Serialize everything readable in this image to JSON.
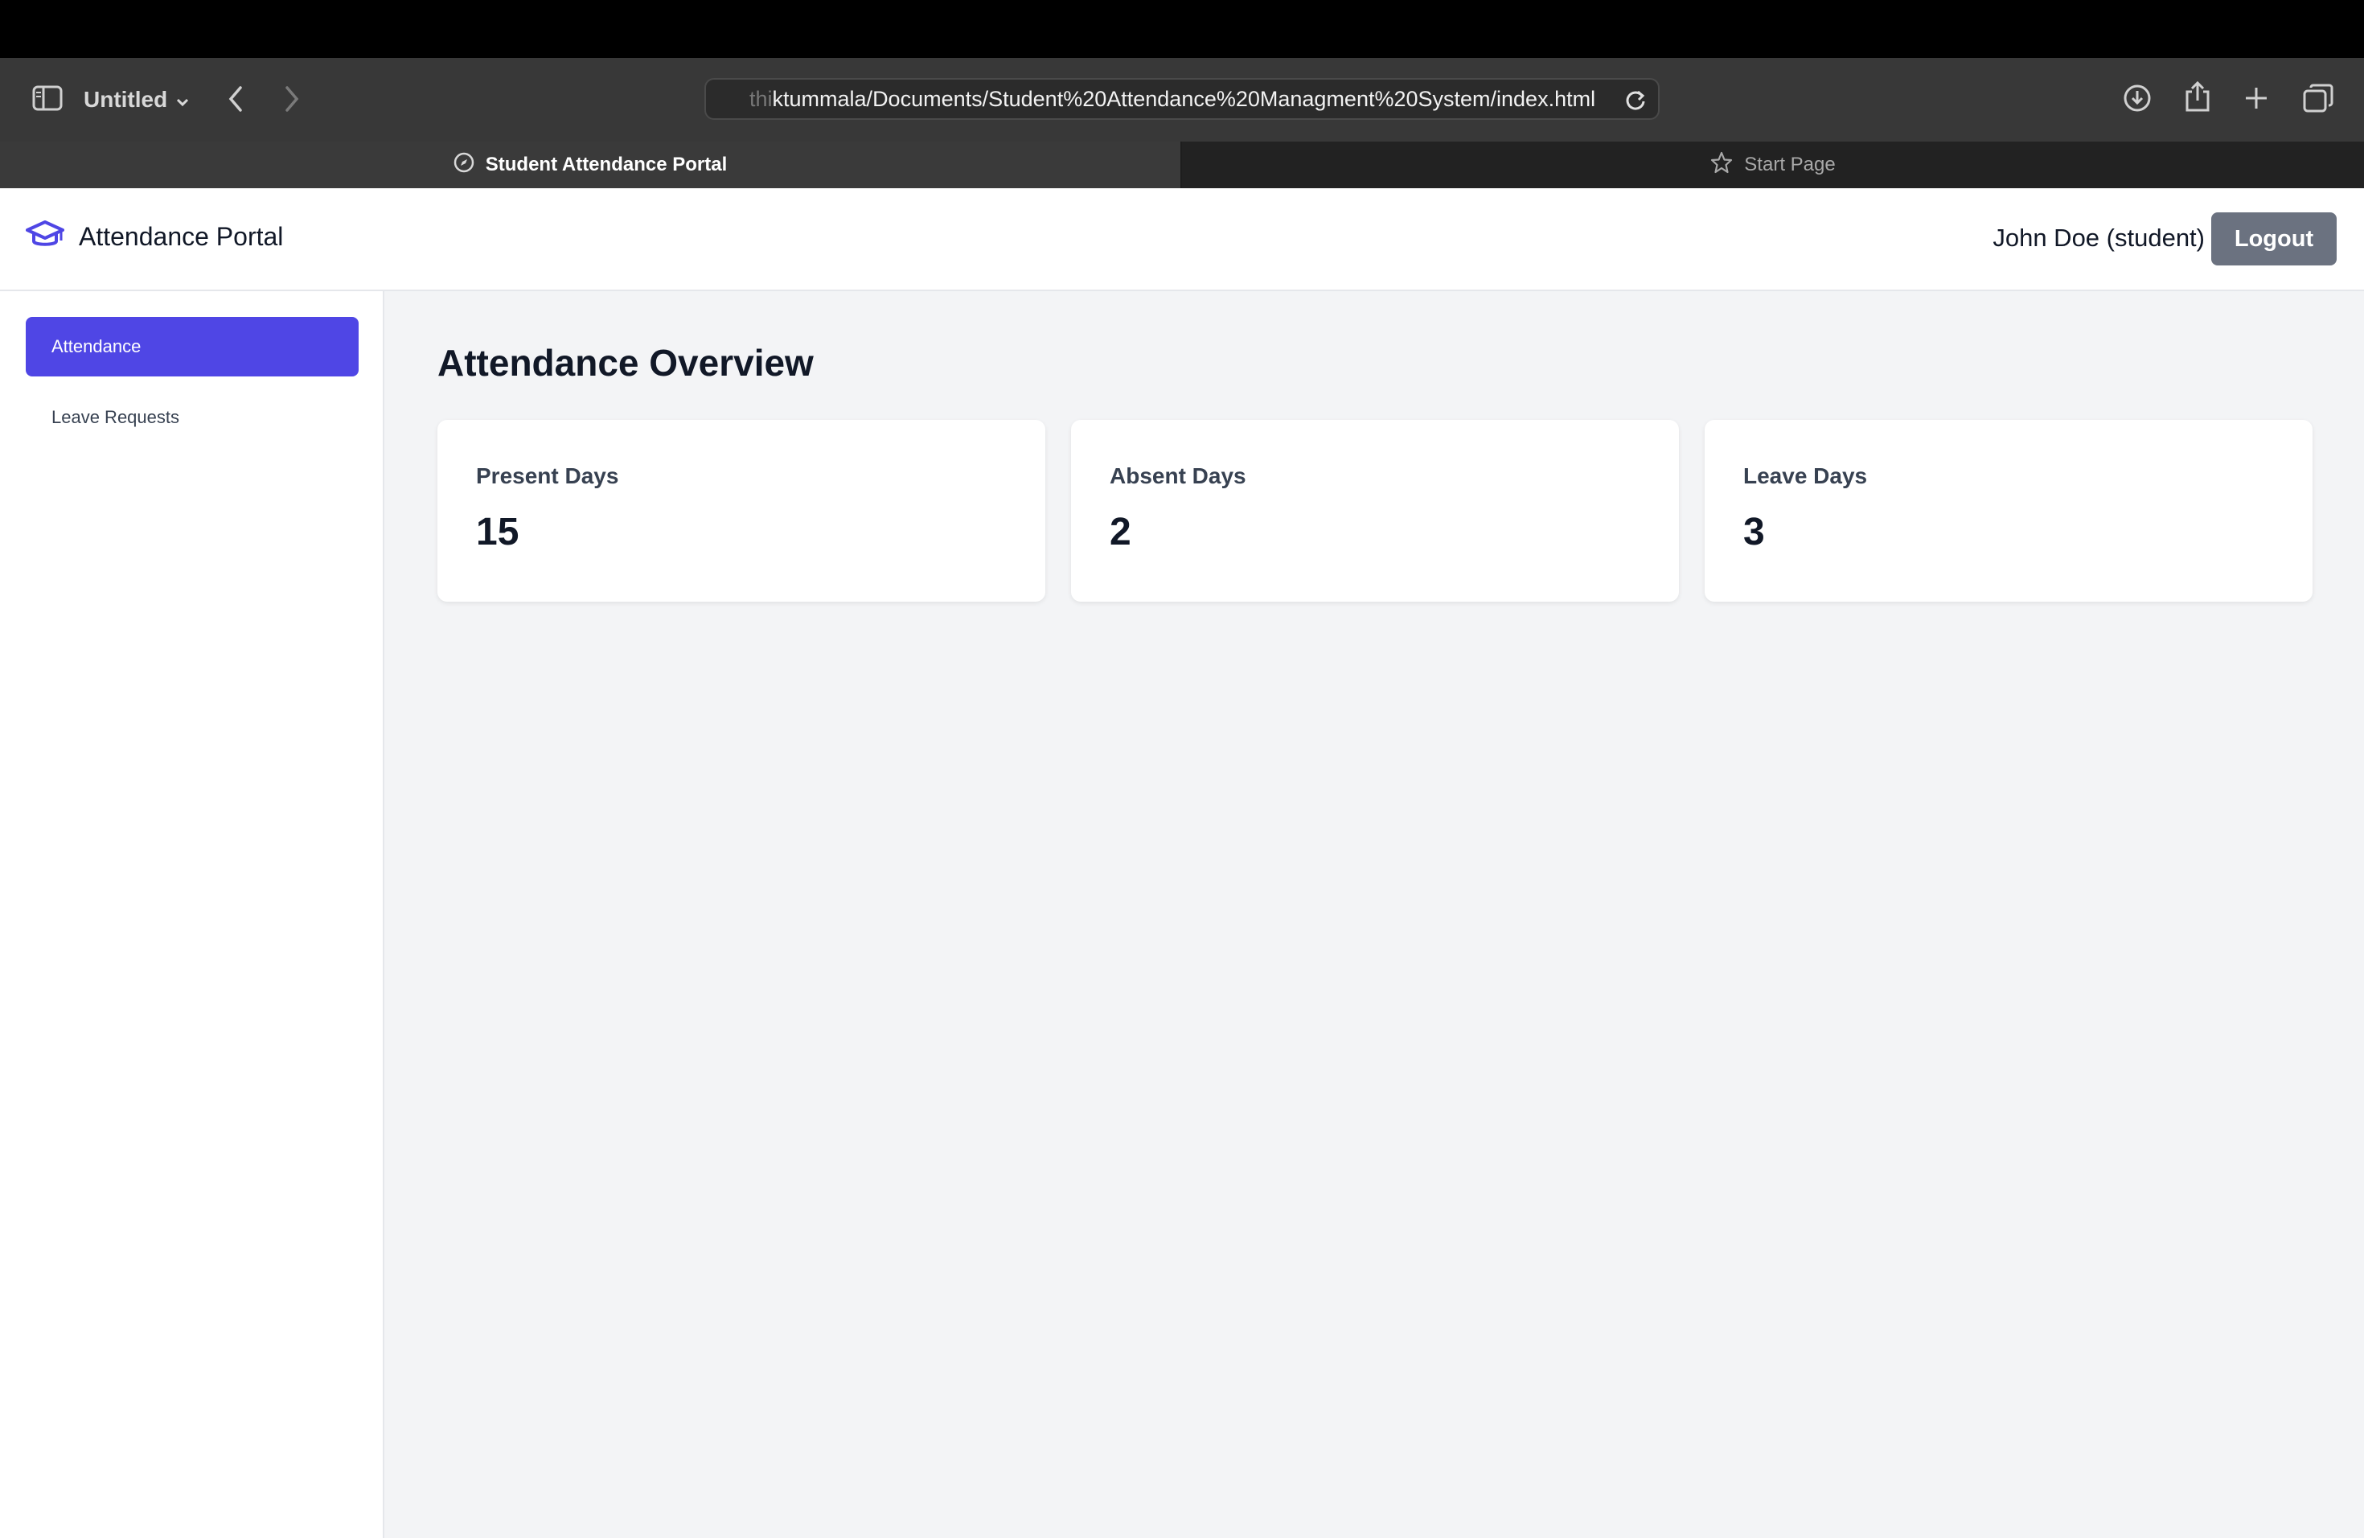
{
  "browser": {
    "window_title": "Untitled",
    "address_faded": "thi",
    "address_main": "ktummala/Documents/Student%20Attendance%20Managment%20System/index.html",
    "tabs": [
      {
        "label": "Student Attendance Portal",
        "active": true
      },
      {
        "label": "Start Page",
        "active": false
      }
    ],
    "icons": [
      "sidebar-toggle-icon",
      "chevron-down-icon",
      "back-arrow-icon",
      "forward-arrow-icon",
      "reload-icon",
      "download-icon",
      "share-icon",
      "new-tab-plus-icon",
      "tab-overview-icon",
      "compass-icon",
      "star-icon"
    ]
  },
  "header": {
    "brand_name": "Attendance Portal",
    "brand_icon": "graduation-cap-icon",
    "brand_color": "#4f46e5",
    "user": "John Doe (student)",
    "logout_label": "Logout"
  },
  "sidebar": {
    "items": [
      {
        "label": "Attendance",
        "active": true
      },
      {
        "label": "Leave Requests",
        "active": false
      }
    ]
  },
  "main": {
    "title": "Attendance Overview",
    "cards": [
      {
        "label": "Present Days",
        "value": "15"
      },
      {
        "label": "Absent Days",
        "value": "2"
      },
      {
        "label": "Leave Days",
        "value": "3"
      }
    ]
  }
}
